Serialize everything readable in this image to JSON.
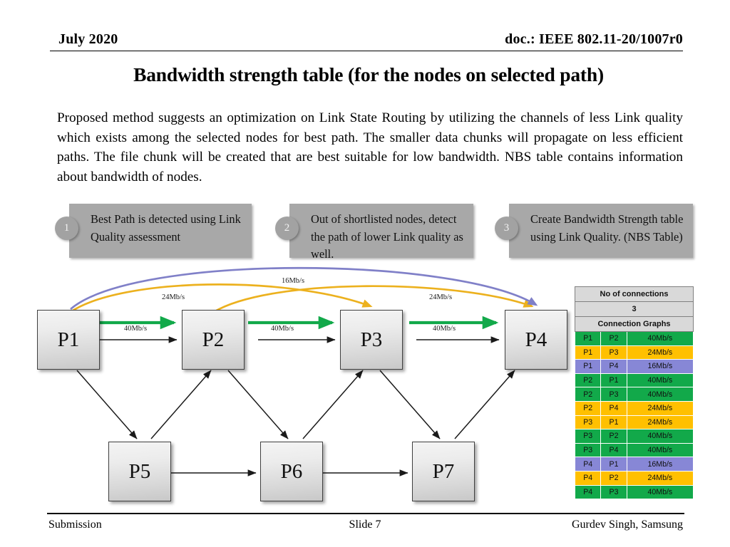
{
  "header": {
    "date": "July 2020",
    "doc": "doc.: IEEE 802.11-20/1007r0"
  },
  "title": "Bandwidth strength table (for the nodes on selected path)",
  "paragraph": "Proposed method suggests an optimization on Link State Routing by utilizing the channels of less Link quality which exists among the selected nodes for best path. The smaller data chunks will propagate on less efficient paths. The file chunk will be created that are best suitable for low bandwidth. NBS table contains information about bandwidth of nodes.",
  "callouts": [
    {
      "number": "1",
      "text": "Best Path is detected using Link Quality assessment"
    },
    {
      "number": "2",
      "text": "Out of shortlisted nodes, detect the path of lower Link quality as well."
    },
    {
      "number": "3",
      "text": "Create Bandwidth Strength table using Link Quality. (NBS Table)"
    }
  ],
  "diagram": {
    "nodes": [
      {
        "id": "P1",
        "label": "P1"
      },
      {
        "id": "P2",
        "label": "P2"
      },
      {
        "id": "P3",
        "label": "P3"
      },
      {
        "id": "P4",
        "label": "P4"
      },
      {
        "id": "P5",
        "label": "P5"
      },
      {
        "id": "P6",
        "label": "P6"
      },
      {
        "id": "P7",
        "label": "P7"
      }
    ],
    "edge_labels": {
      "p1_p2_green": "40Mb/s",
      "p2_p3_green": "40Mb/s",
      "p3_p4_green": "40Mb/s",
      "p1_p3_amber": "24Mb/s",
      "p2_p4_amber": "24Mb/s",
      "p1_p4_purple": "16Mb/s"
    },
    "colors": {
      "green": "#12a94a",
      "amber": "#ecb11e",
      "purple": "#8080c8",
      "black": "#1a1a1a"
    }
  },
  "nbs_table": {
    "header_label": "No of connections",
    "header_value": "3",
    "section_label": "Connection Graphs",
    "rows": [
      {
        "from": "P1",
        "to": "P2",
        "rate": "40Mb/s",
        "color": "g"
      },
      {
        "from": "P1",
        "to": "P3",
        "rate": "24Mb/s",
        "color": "a"
      },
      {
        "from": "P1",
        "to": "P4",
        "rate": "16Mb/s",
        "color": "p"
      },
      {
        "from": "P2",
        "to": "P1",
        "rate": "40Mb/s",
        "color": "g"
      },
      {
        "from": "P2",
        "to": "P3",
        "rate": "40Mb/s",
        "color": "g"
      },
      {
        "from": "P2",
        "to": "P4",
        "rate": "24Mb/s",
        "color": "a"
      },
      {
        "from": "P3",
        "to": "P1",
        "rate": "24Mb/s",
        "color": "a"
      },
      {
        "from": "P3",
        "to": "P2",
        "rate": "40Mb/s",
        "color": "g"
      },
      {
        "from": "P3",
        "to": "P4",
        "rate": "40Mb/s",
        "color": "g"
      },
      {
        "from": "P4",
        "to": "P1",
        "rate": "16Mb/s",
        "color": "p"
      },
      {
        "from": "P4",
        "to": "P2",
        "rate": "24Mb/s",
        "color": "a"
      },
      {
        "from": "P4",
        "to": "P3",
        "rate": "40Mb/s",
        "color": "g"
      }
    ]
  },
  "footer": {
    "left": "Submission",
    "center": "Slide 7",
    "right": "Gurdev Singh, Samsung"
  }
}
